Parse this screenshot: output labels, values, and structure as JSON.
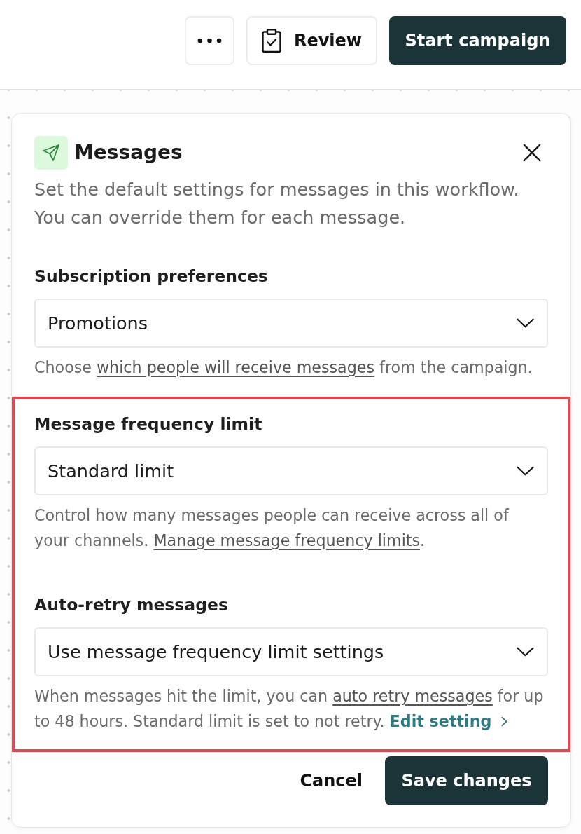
{
  "toolbar": {
    "buttons": [
      {
        "kind": "overflow"
      },
      {
        "kind": "secondary",
        "label": "Review"
      },
      {
        "kind": "primary",
        "label": "Start campaign"
      }
    ]
  },
  "panel": {
    "title": "Messages",
    "description": "Set the default settings for messages in this workflow. You can override them for each message.",
    "groups": [
      {
        "highlighted": false,
        "sections": [
          {
            "label": "Subscription preferences",
            "value": "Promotions",
            "help": [
              {
                "kind": "text",
                "text": "Choose "
              },
              {
                "kind": "link",
                "text": "which people will receive messages"
              },
              {
                "kind": "text",
                "text": " from the campaign."
              }
            ]
          }
        ]
      },
      {
        "highlighted": true,
        "sections": [
          {
            "label": "Message frequency limit",
            "value": "Standard limit",
            "help": [
              {
                "kind": "text",
                "text": "Control how many messages people can receive across all of your channels. "
              },
              {
                "kind": "link",
                "text": "Manage message frequency limits"
              },
              {
                "kind": "text",
                "text": "."
              }
            ]
          },
          {
            "label": "Auto-retry messages",
            "value": "Use message frequency limit settings",
            "help": [
              {
                "kind": "text",
                "text": "When messages hit the limit, you can "
              },
              {
                "kind": "link",
                "text": "auto retry messages"
              },
              {
                "kind": "text",
                "text": " for up to 48 hours. Standard limit is set to not retry. "
              },
              {
                "kind": "action",
                "text": "Edit setting"
              }
            ]
          }
        ]
      }
    ],
    "footer": {
      "cancel": "Cancel",
      "save": "Save changes"
    }
  }
}
